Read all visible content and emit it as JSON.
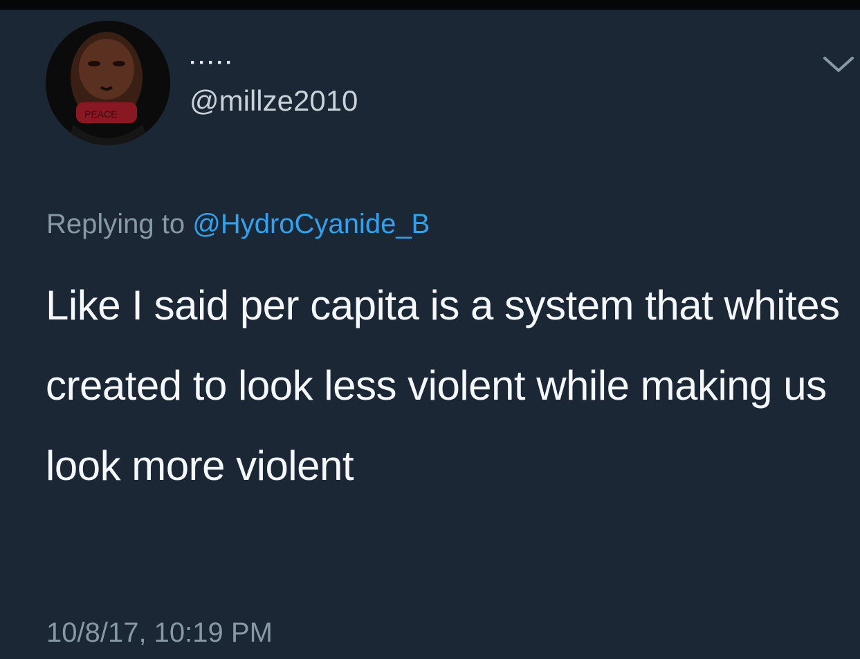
{
  "tweet": {
    "display_name": "·····",
    "handle": "@millze2010",
    "replying_prefix": "Replying to",
    "replying_to": "@HydroCyanide_B",
    "text": "Like I said per capita is a system that whites created to look less violent while making us look more violent",
    "timestamp": "10/8/17, 10:19 PM"
  },
  "icons": {
    "avatar": "avatar-photo",
    "menu": "chevron-down-icon"
  },
  "colors": {
    "background": "#1c2735",
    "text": "#f5f8fa",
    "secondary": "#8899a6",
    "mention": "#2fa3f0"
  }
}
